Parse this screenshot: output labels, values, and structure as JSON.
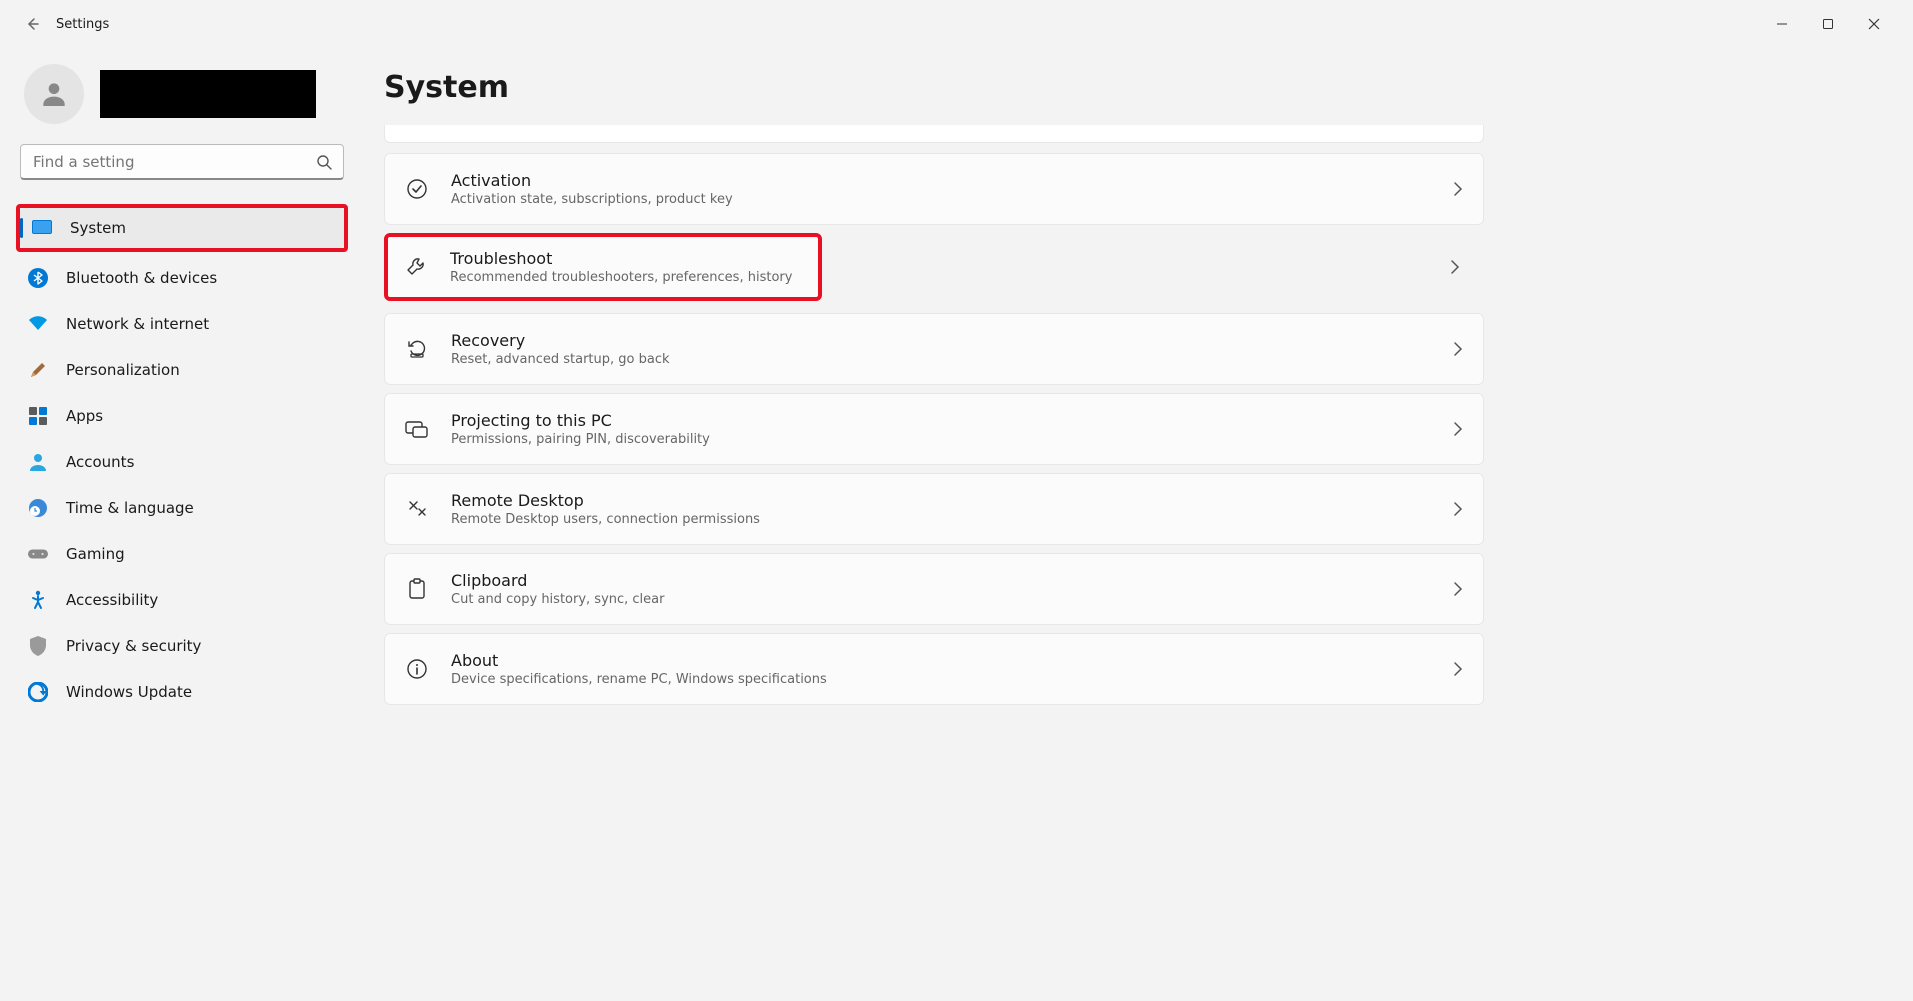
{
  "window": {
    "title": "Settings"
  },
  "search": {
    "placeholder": "Find a setting"
  },
  "page": {
    "heading": "System"
  },
  "nav": {
    "items": [
      {
        "label": "System"
      },
      {
        "label": "Bluetooth & devices"
      },
      {
        "label": "Network & internet"
      },
      {
        "label": "Personalization"
      },
      {
        "label": "Apps"
      },
      {
        "label": "Accounts"
      },
      {
        "label": "Time & language"
      },
      {
        "label": "Gaming"
      },
      {
        "label": "Accessibility"
      },
      {
        "label": "Privacy & security"
      },
      {
        "label": "Windows Update"
      }
    ]
  },
  "cards": [
    {
      "title": "Activation",
      "sub": "Activation state, subscriptions, product key"
    },
    {
      "title": "Troubleshoot",
      "sub": "Recommended troubleshooters, preferences, history"
    },
    {
      "title": "Recovery",
      "sub": "Reset, advanced startup, go back"
    },
    {
      "title": "Projecting to this PC",
      "sub": "Permissions, pairing PIN, discoverability"
    },
    {
      "title": "Remote Desktop",
      "sub": "Remote Desktop users, connection permissions"
    },
    {
      "title": "Clipboard",
      "sub": "Cut and copy history, sync, clear"
    },
    {
      "title": "About",
      "sub": "Device specifications, rename PC, Windows specifications"
    }
  ]
}
